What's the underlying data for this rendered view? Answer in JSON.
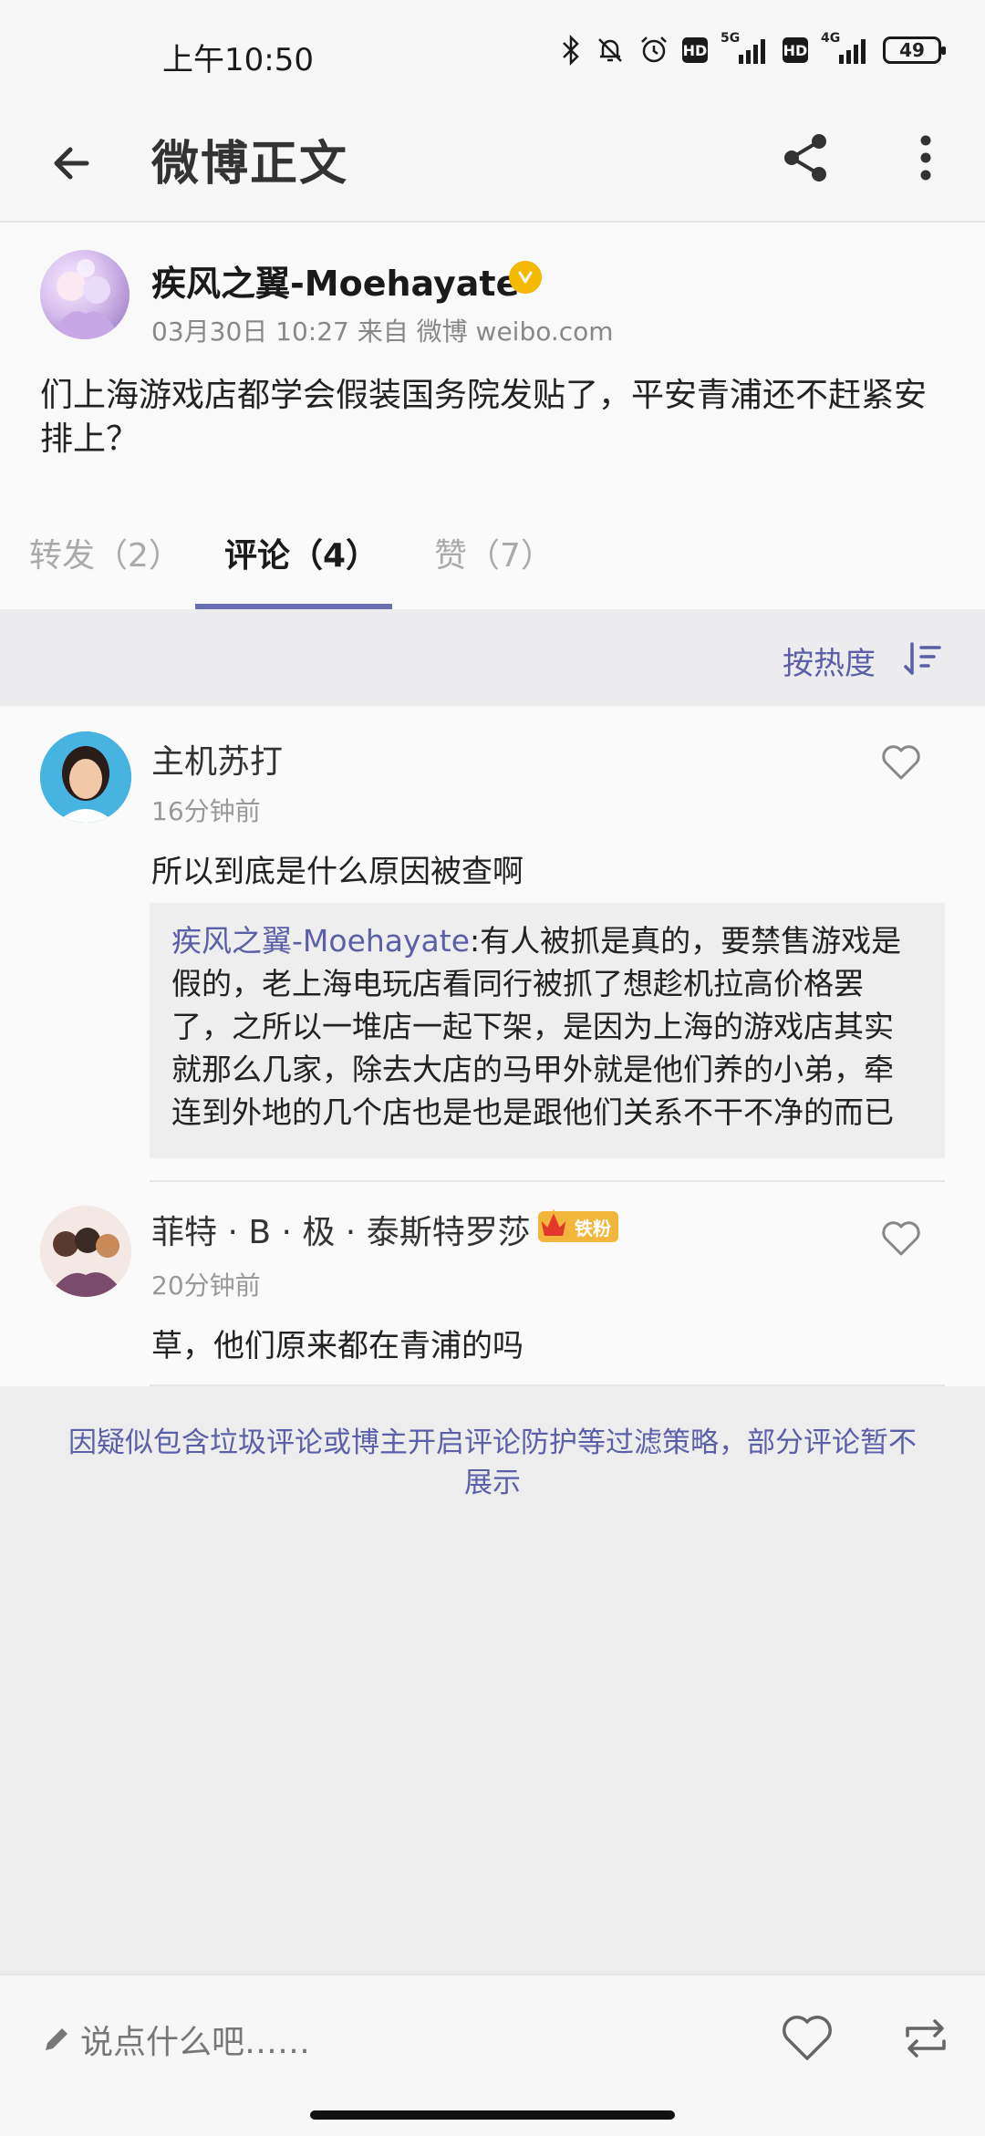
{
  "status_bar": {
    "time": "上午10:50",
    "hd1": "HD",
    "net1": "5G",
    "hd2": "HD",
    "net2": "4G",
    "battery": "49",
    "icons": [
      "bluetooth-icon",
      "bell-off-icon",
      "alarm-icon",
      "signal-icon",
      "battery-icon"
    ]
  },
  "header": {
    "title": "微博正文",
    "icons": [
      "back-arrow-icon",
      "share-icon",
      "more-icon"
    ]
  },
  "post": {
    "author": "疾风之翼-Moehayate",
    "verified_color": "#f5b800",
    "meta": "03月30日 10:27   来自 微博 weibo.com",
    "text": "们上海游戏店都学会假装国务院发贴了，平安青浦还不赶紧安排上？"
  },
  "tabs": [
    {
      "label": "转发（2）"
    },
    {
      "label": "评论（4）"
    },
    {
      "label": "赞（7）"
    }
  ],
  "sort": {
    "label": "按热度"
  },
  "comments": [
    {
      "name": "主机苏打",
      "time": "16分钟前",
      "text": "所以到底是什么原因被查啊",
      "quote_author": "疾风之翼-Moehayate",
      "quote_text": ":有人被抓是真的，要禁售游戏是假的，老上海电玩店看同行被抓了想趁机拉高价格罢了，之所以一堆店一起下架，是因为上海的游戏店其实就那么几家，除去大店的马甲外就是他们养的小弟，牵连到外地的几个店也是也是跟他们关系不干不净的而已"
    },
    {
      "name": "菲特 · B · 极 · 泰斯特罗莎",
      "badge": "铁粉",
      "time": "20分钟前",
      "text": "草，他们原来都在青浦的吗"
    }
  ],
  "filter_note": "因疑似包含垃圾评论或博主开启评论防护等过滤策略，部分评论暂不展示",
  "bottom_bar": {
    "placeholder": "说点什么吧……",
    "icons": [
      "pencil-icon",
      "heart-icon",
      "repost-icon"
    ]
  },
  "colors": {
    "accent": "#5a5fa8",
    "tab_underline": "#6a6fb1",
    "background": "#ededee"
  }
}
